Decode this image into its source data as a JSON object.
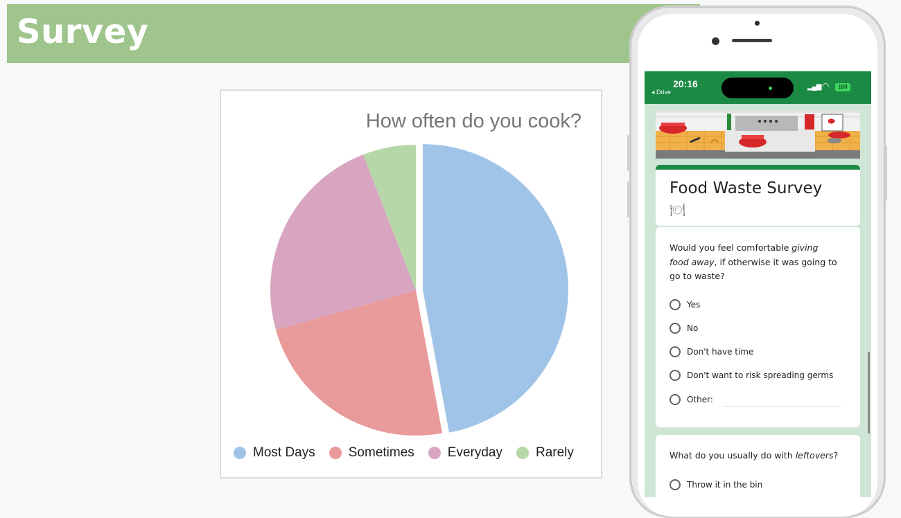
{
  "banner": {
    "title": "Survey",
    "color": "#9fc58c"
  },
  "chart_data": {
    "type": "pie",
    "title": "How often do you cook?",
    "slices": [
      {
        "label": "Most Days",
        "value": 47.1,
        "color": "#a0c4e8",
        "exploded": true
      },
      {
        "label": "Sometimes",
        "value": 23.5,
        "color": "#e99a9a"
      },
      {
        "label": "Everyday",
        "value": 23.5,
        "color": "#d7a5c0"
      },
      {
        "label": "Rarely",
        "value": 5.9,
        "color": "#b6d7a8"
      }
    ],
    "legend_position": "bottom"
  },
  "phone": {
    "status": {
      "time": "20:16",
      "back_label": "◂ Drive",
      "battery": "100"
    },
    "form": {
      "title": "Food Waste Survey",
      "title_icon": "plate-icon",
      "question1": {
        "text_parts": [
          "Would you feel comfortable ",
          "giving food away",
          ", if otherwise it was going to go to waste?"
        ],
        "options": [
          "Yes",
          "No",
          "Don't have time",
          "Don't want to risk spreading germs",
          "Other:"
        ]
      },
      "question2": {
        "text_parts": [
          "What do you usually do with ",
          "leftovers",
          "?"
        ],
        "options": [
          "Throw it in the bin"
        ]
      }
    },
    "accent_color": "#1a8a45"
  }
}
